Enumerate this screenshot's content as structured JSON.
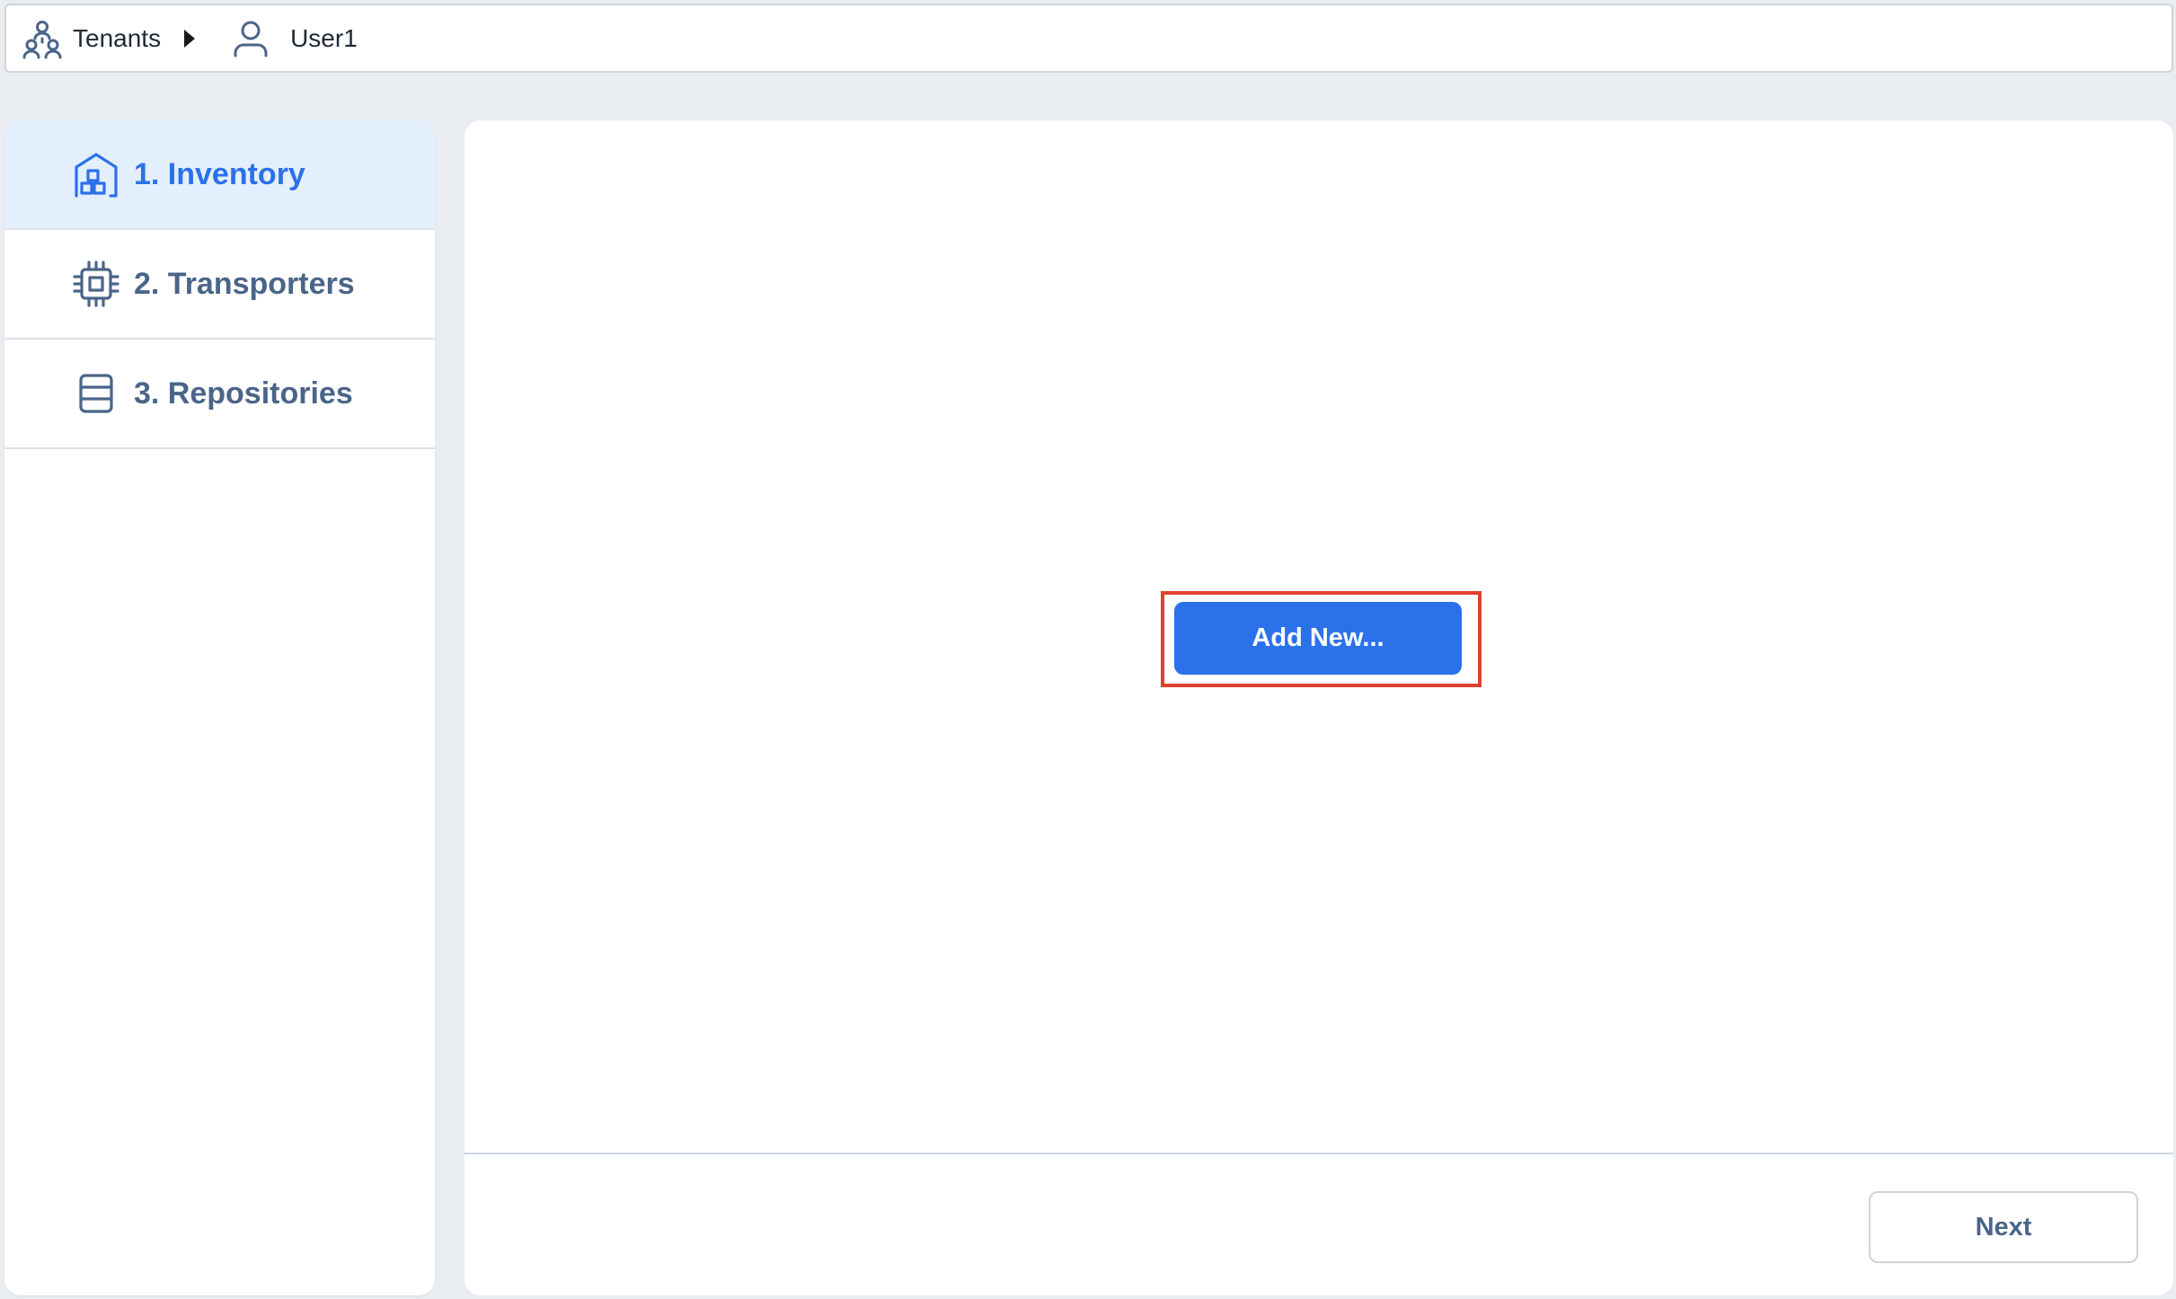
{
  "breadcrumb": {
    "items": [
      {
        "label": "Tenants",
        "icon": "tenants-icon"
      },
      {
        "label": "User1",
        "icon": "user-icon"
      }
    ],
    "separator_icon": "caret-right-icon"
  },
  "sidebar": {
    "items": [
      {
        "label": "1. Inventory",
        "icon": "inventory-icon",
        "active": true
      },
      {
        "label": "2. Transporters",
        "icon": "chip-icon",
        "active": false
      },
      {
        "label": "3. Repositories",
        "icon": "database-icon",
        "active": false
      }
    ]
  },
  "main": {
    "add_new_label": "Add New...",
    "next_label": "Next"
  },
  "colors": {
    "accent": "#2b72ea",
    "active_bg": "#e4effd",
    "inactive_text": "#4a6589",
    "highlight_border": "#e0412f",
    "page_bg": "#e9ecf0"
  }
}
